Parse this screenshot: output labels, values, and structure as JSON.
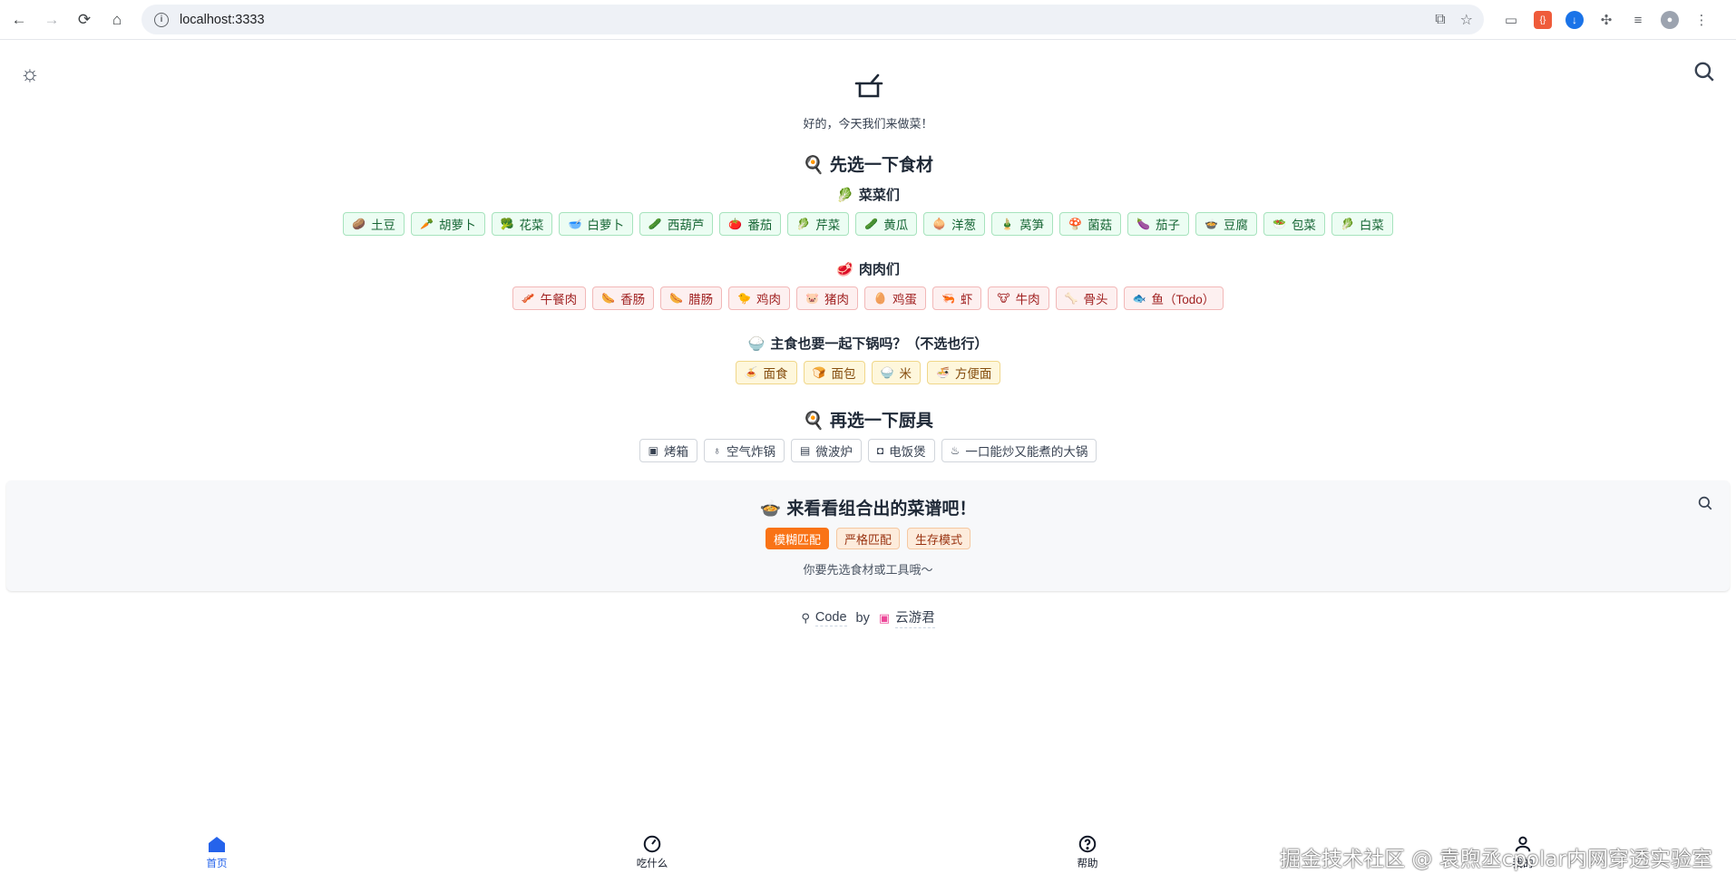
{
  "browser": {
    "url": "localhost:3333",
    "back_icon": "arrow-left-icon",
    "forward_icon": "arrow-right-icon",
    "reload_icon": "reload-icon",
    "home_icon": "home-icon"
  },
  "header": {
    "theme_icon": "sun-icon",
    "search_icon": "search-icon",
    "logo_icon": "pot-icon",
    "subtitle": "好的，今天我们来做菜！"
  },
  "ingredients": {
    "title_emoji": "🍳",
    "title": "先选一下食材",
    "vegetables": {
      "emoji": "🥬",
      "title": "菜菜们",
      "items": [
        {
          "emoji": "🥔",
          "label": "土豆"
        },
        {
          "emoji": "🥕",
          "label": "胡萝卜"
        },
        {
          "emoji": "🥦",
          "label": "花菜"
        },
        {
          "emoji": "🥣",
          "label": "白萝卜"
        },
        {
          "emoji": "🥒",
          "label": "西葫芦"
        },
        {
          "emoji": "🍅",
          "label": "番茄"
        },
        {
          "emoji": "🥬",
          "label": "芹菜"
        },
        {
          "emoji": "🥒",
          "label": "黄瓜"
        },
        {
          "emoji": "🧅",
          "label": "洋葱"
        },
        {
          "emoji": "🎍",
          "label": "莴笋"
        },
        {
          "emoji": "🍄",
          "label": "菌菇"
        },
        {
          "emoji": "🍆",
          "label": "茄子"
        },
        {
          "emoji": "🍲",
          "label": "豆腐"
        },
        {
          "emoji": "🥗",
          "label": "包菜"
        },
        {
          "emoji": "🥬",
          "label": "白菜"
        }
      ]
    },
    "meats": {
      "emoji": "🥩",
      "title": "肉肉们",
      "items": [
        {
          "emoji": "🥓",
          "label": "午餐肉"
        },
        {
          "emoji": "🌭",
          "label": "香肠"
        },
        {
          "emoji": "🌭",
          "label": "腊肠"
        },
        {
          "emoji": "🐤",
          "label": "鸡肉"
        },
        {
          "emoji": "🐷",
          "label": "猪肉"
        },
        {
          "emoji": "🥚",
          "label": "鸡蛋"
        },
        {
          "emoji": "🦐",
          "label": "虾"
        },
        {
          "emoji": "🐮",
          "label": "牛肉"
        },
        {
          "emoji": "🦴",
          "label": "骨头"
        },
        {
          "emoji": "🐟",
          "label": "鱼（Todo）"
        }
      ]
    },
    "staples": {
      "emoji": "🍚",
      "title": "主食也要一起下锅吗？（不选也行）",
      "items": [
        {
          "emoji": "🍝",
          "label": "面食"
        },
        {
          "emoji": "🍞",
          "label": "面包"
        },
        {
          "emoji": "🍚",
          "label": "米"
        },
        {
          "emoji": "🍜",
          "label": "方便面"
        }
      ]
    }
  },
  "tools": {
    "title_emoji": "🍳",
    "title": "再选一下厨具",
    "items": [
      {
        "icon": "oven-icon",
        "glyph": "▣",
        "label": "烤箱"
      },
      {
        "icon": "air-fryer-icon",
        "glyph": "♁",
        "label": "空气炸锅"
      },
      {
        "icon": "microwave-icon",
        "glyph": "▤",
        "label": "微波炉"
      },
      {
        "icon": "rice-cooker-icon",
        "glyph": "◘",
        "label": "电饭煲"
      },
      {
        "icon": "wok-icon",
        "glyph": "♨",
        "label": "一口能炒又能煮的大锅"
      }
    ]
  },
  "result": {
    "emoji": "🍲",
    "title": "来看看组合出的菜谱吧！",
    "modes": [
      "模糊匹配",
      "严格匹配",
      "生存模式"
    ],
    "active_mode": "模糊匹配",
    "hint": "你要先选食材或工具哦～"
  },
  "credit": {
    "code_label": "Code",
    "by_label": "by",
    "author": "云游君"
  },
  "bottom_nav": [
    {
      "label": "首页",
      "icon": "home-icon",
      "active": true
    },
    {
      "label": "吃什么",
      "icon": "compass-icon",
      "active": false
    },
    {
      "label": "帮助",
      "icon": "help-icon",
      "active": false
    },
    {
      "label": "我的",
      "icon": "user-icon",
      "active": false
    }
  ],
  "watermark": "掘金技术社区 @ 袁煦丞cpolar内网穿透实验室",
  "colors": {
    "accent": "#f97316",
    "nav_active": "#2563eb",
    "veg_bg": "#ecfdf3",
    "meat_bg": "#fdf0f0",
    "staple_bg": "#fef7dc"
  }
}
